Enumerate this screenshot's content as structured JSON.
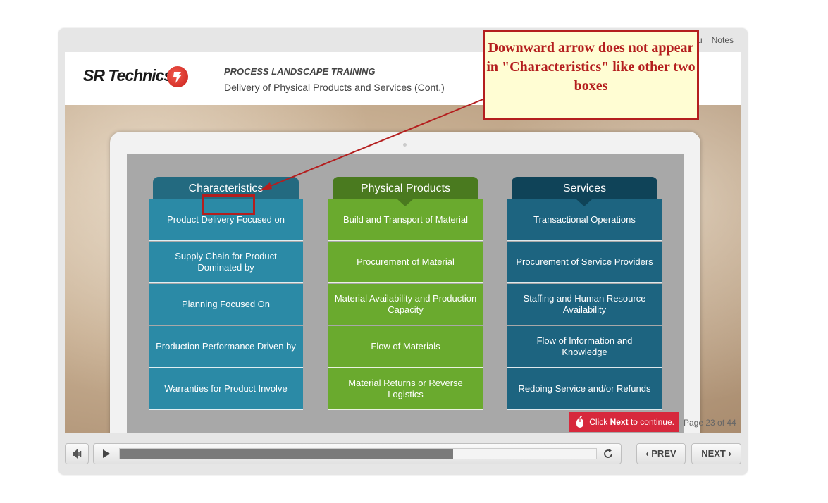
{
  "topnav": {
    "menu_partial": "u",
    "notes": "Notes"
  },
  "header": {
    "logo_text": "SR Technics",
    "course_title": "PROCESS LANDSCAPE TRAINING",
    "slide_title": "Delivery of Physical Products and Services (Cont.)"
  },
  "columns": [
    {
      "title": "Characteristics",
      "color": "#2b8aa6",
      "tab_color": "#236a80",
      "items": [
        "Product Delivery Focused on",
        "Supply Chain for Product Dominated by",
        "Planning Focused On",
        "Production Performance Driven by",
        "Warranties for Product Involve"
      ]
    },
    {
      "title": "Physical Products",
      "color": "#6aaa2e",
      "tab_color": "#4a7a1f",
      "items": [
        "Build and Transport of Material",
        "Procurement of Material",
        "Material Availability and Production Capacity",
        "Flow of Materials",
        "Material Returns or Reverse Logistics"
      ]
    },
    {
      "title": "Services",
      "color": "#1d6480",
      "tab_color": "#0f4358",
      "items": [
        "Transactional Operations",
        "Procurement of Service Providers",
        "Staffing and Human Resource Availability",
        "Flow of Information and Knowledge",
        "Redoing Service and/or Refunds"
      ]
    }
  ],
  "footer": {
    "click_prefix": "Click ",
    "click_bold": "Next",
    "click_suffix": " to continue.",
    "page_count": "Page 23 of 44"
  },
  "controls": {
    "prev_label": "PREV",
    "next_label": "NEXT",
    "progress": 0.7
  },
  "annotation": {
    "callout_text": "Downward arrow does not appear in \"Characteristics\" like other two boxes"
  }
}
